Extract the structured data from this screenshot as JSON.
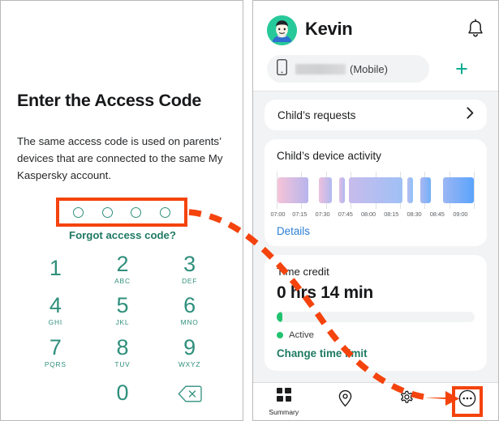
{
  "access_panel": {
    "title": "Enter the Access Code",
    "description": "The same access code is used on parents’ devices that are connected to the same My Kaspersky account.",
    "code_dots": 4,
    "forgot_link": "Forgot access code?",
    "keypad": [
      {
        "num": "1",
        "sub": ""
      },
      {
        "num": "2",
        "sub": "ABC"
      },
      {
        "num": "3",
        "sub": "DEF"
      },
      {
        "num": "4",
        "sub": "GHI"
      },
      {
        "num": "5",
        "sub": "JKL"
      },
      {
        "num": "6",
        "sub": "MNO"
      },
      {
        "num": "7",
        "sub": "PQRS"
      },
      {
        "num": "8",
        "sub": "TUV"
      },
      {
        "num": "9",
        "sub": "WXYZ"
      },
      {
        "num": "0",
        "sub": ""
      }
    ],
    "delete_key": "backspace-key"
  },
  "app_panel": {
    "header": {
      "child_name": "Kevin",
      "avatar": "child-avatar",
      "bell_icon": "notification-bell-icon",
      "device_chip": {
        "phone_icon": "phone-icon",
        "device_name_redacted": "",
        "device_type": "(Mobile)"
      },
      "add_device": "+"
    },
    "requests_card": {
      "label": "Child’s requests",
      "chevron": "chevron-right-icon"
    },
    "activity_card": {
      "title": "Child’s device activity",
      "details_link": "Details"
    },
    "credit_card": {
      "label": "Time credit",
      "value": "0 hrs 14 min",
      "progress_percent": 3,
      "status": "Active",
      "status_color": "#21c36f",
      "action_link": "Change time limit"
    },
    "bottom_nav": [
      {
        "label": "Summary",
        "icon": "grid-summary-icon",
        "active": true
      },
      {
        "label": "",
        "icon": "location-pin-icon",
        "active": false
      },
      {
        "label": "",
        "icon": "gear-settings-icon",
        "active": false
      },
      {
        "label": "",
        "icon": "more-dots-icon",
        "active": false,
        "highlighted": true
      }
    ]
  },
  "annotations": {
    "highlight_color": "#f4430d",
    "arrow_style": "dashed-curved-arrow",
    "targets": [
      "access-code-dots",
      "more-dots-nav-button"
    ]
  },
  "chart_data": {
    "type": "bar",
    "title": "Child’s device activity",
    "xlabel": "",
    "ylabel": "",
    "grid": true,
    "legend": false,
    "categories": [
      "07:00",
      "07:15",
      "07:30",
      "07:45",
      "08:00",
      "08:15",
      "08:30",
      "08:45",
      "09:00"
    ],
    "tick_labels": [
      "07:00",
      "07:15",
      "07:30",
      "07:45",
      "08:00",
      "08:15",
      "08:30",
      "08:45",
      "09:00"
    ],
    "xlim": [
      "07:00",
      "09:00"
    ],
    "segments": [
      {
        "start_pct": 0.5,
        "width_pct": 15.5,
        "color_from": "#b7b5ec",
        "color_to": "#f6c3d8"
      },
      {
        "start_pct": 21.5,
        "width_pct": 6.5,
        "color_from": "#b1b9ef",
        "color_to": "#edc0dd"
      },
      {
        "start_pct": 31.5,
        "width_pct": 3.0,
        "color_from": "#adb9f0",
        "color_to": "#e3bee3"
      },
      {
        "start_pct": 36.5,
        "width_pct": 27.0,
        "color_from": "#9fc0f5",
        "color_to": "#c8bcec"
      },
      {
        "start_pct": 65.8,
        "width_pct": 3.0,
        "color_from": "#8fc1f8",
        "color_to": "#b7bdf0"
      },
      {
        "start_pct": 72.5,
        "width_pct": 5.5,
        "color_from": "#72aff9",
        "color_to": "#aab8f2"
      },
      {
        "start_pct": 84.0,
        "width_pct": 15.5,
        "color_from": "#5aa4fb",
        "color_to": "#9cb6f4"
      }
    ]
  }
}
